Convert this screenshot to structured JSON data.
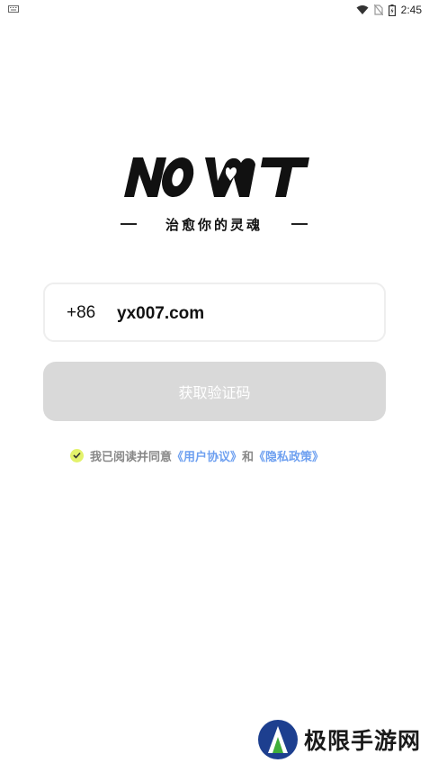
{
  "status_bar": {
    "time": "2:45",
    "icons": [
      "keyboard-icon",
      "wifi-icon",
      "no-sim-icon",
      "battery-icon"
    ]
  },
  "branding": {
    "logo_text": "NOWT",
    "tagline": "治愈你的灵魂"
  },
  "login": {
    "country_code": "+86",
    "phone_value": "yx007.com",
    "get_code_button": "获取验证码"
  },
  "agreement": {
    "checked": true,
    "prefix": "我已阅读并同意",
    "user_agreement_link": "《用户协议》",
    "conjunction": "和",
    "privacy_policy_link": "《隐私政策》"
  },
  "watermark": {
    "text": "极限手游网"
  },
  "colors": {
    "button_disabled": "#d9d9d9",
    "link": "#6ea0f0",
    "check_accent": "#e3f26b",
    "input_border": "#eeeeee"
  }
}
